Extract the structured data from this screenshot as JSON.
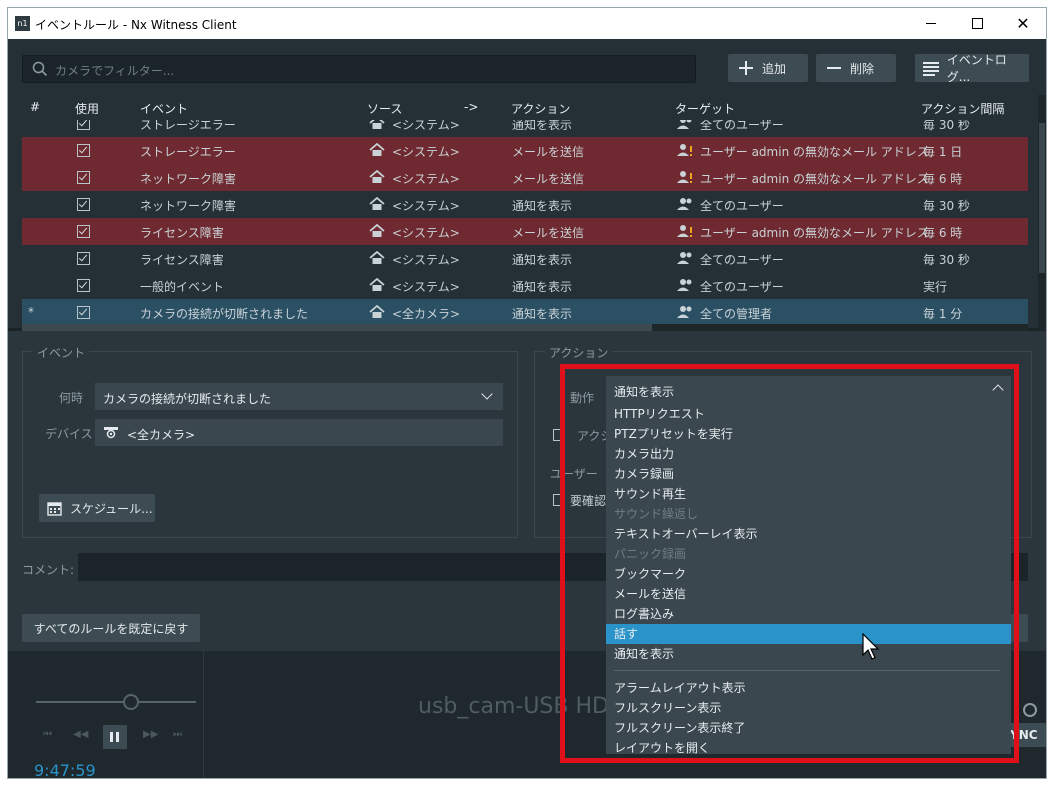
{
  "window": {
    "title": "イベントルール - Nx Witness Client",
    "app_icon": "n1"
  },
  "toolbar": {
    "filter_placeholder": "カメラでフィルター...",
    "add": "追加",
    "remove": "削除",
    "event_log": "イベントログ..."
  },
  "columns": {
    "num": "#",
    "use": "使用",
    "event": "イベント",
    "source": "ソース",
    "arrow": "->",
    "action": "アクション",
    "target": "ターゲット",
    "interval": "アクション間隔"
  },
  "rows": [
    {
      "event": "ストレージエラー",
      "source": "<システム>",
      "action": "通知を表示",
      "target": "全てのユーザー",
      "interval": "毎 30 秒",
      "state": "normal",
      "warn": false
    },
    {
      "event": "ストレージエラー",
      "source": "<システム>",
      "action": "メールを送信",
      "target": "ユーザー admin の無効なメール アドレス",
      "interval": "毎 1 日",
      "state": "bad",
      "warn": true
    },
    {
      "event": "ネットワーク障害",
      "source": "<システム>",
      "action": "メールを送信",
      "target": "ユーザー admin の無効なメール アドレス",
      "interval": "毎 6 時",
      "state": "bad",
      "warn": true
    },
    {
      "event": "ネットワーク障害",
      "source": "<システム>",
      "action": "通知を表示",
      "target": "全てのユーザー",
      "interval": "毎 30 秒",
      "state": "normal",
      "warn": false
    },
    {
      "event": "ライセンス障害",
      "source": "<システム>",
      "action": "メールを送信",
      "target": "ユーザー admin の無効なメール アドレス",
      "interval": "毎 6 時",
      "state": "bad",
      "warn": true
    },
    {
      "event": "ライセンス障害",
      "source": "<システム>",
      "action": "通知を表示",
      "target": "全てのユーザー",
      "interval": "毎 30 秒",
      "state": "normal",
      "warn": false
    },
    {
      "event": "一般的イベント",
      "source": "<システム>",
      "action": "通知を表示",
      "target": "全てのユーザー",
      "interval": "実行",
      "state": "normal",
      "warn": false
    },
    {
      "num": "*",
      "event": "カメラの接続が切断されました",
      "source": "<全カメラ>",
      "action": "通知を表示",
      "target": "全ての管理者",
      "interval": "毎 1 分",
      "state": "sel",
      "warn": false
    }
  ],
  "event_group": {
    "label": "イベント",
    "when_label": "何時",
    "when_value": "カメラの接続が切断されました",
    "device_label": "デバイス",
    "device_value": "<全カメラ>",
    "schedule": "スケジュール..."
  },
  "action_group": {
    "label": "アクション",
    "do_label": "動作",
    "do_value": "通知を表示",
    "partial_action": "アクシ",
    "user_label": "ユーザー",
    "confirm_label": "要確認"
  },
  "comment_label": "コメント:",
  "reset_all": "すべてのルールを既定に戻す",
  "bottom": {
    "camera_name": "usb_cam-USB HD",
    "time": "9:47:59",
    "sync": "YNC"
  },
  "dropdown": {
    "items": [
      {
        "label": "HTTPリクエスト",
        "disabled": false
      },
      {
        "label": "PTZプリセットを実行",
        "disabled": false
      },
      {
        "label": "カメラ出力",
        "disabled": false
      },
      {
        "label": "カメラ録画",
        "disabled": false
      },
      {
        "label": "サウンド再生",
        "disabled": false
      },
      {
        "label": "サウンド繰返し",
        "disabled": true
      },
      {
        "label": "テキストオーバーレイ表示",
        "disabled": false
      },
      {
        "label": "パニック録画",
        "disabled": true
      },
      {
        "label": "ブックマーク",
        "disabled": false
      },
      {
        "label": "メールを送信",
        "disabled": false
      },
      {
        "label": "ログ書込み",
        "disabled": false
      },
      {
        "label": "話す",
        "disabled": false,
        "highlighted": true
      },
      {
        "label": "通知を表示",
        "disabled": false
      }
    ],
    "items2": [
      {
        "label": "アラームレイアウト表示"
      },
      {
        "label": "フルスクリーン表示"
      },
      {
        "label": "フルスクリーン表示終了"
      },
      {
        "label": "レイアウトを開く"
      }
    ]
  },
  "colors": {
    "bad_row": "#6e2a30",
    "selected_row": "#2b5064",
    "highlight": "#2a93c9",
    "annotation_box": "#e0101a"
  }
}
